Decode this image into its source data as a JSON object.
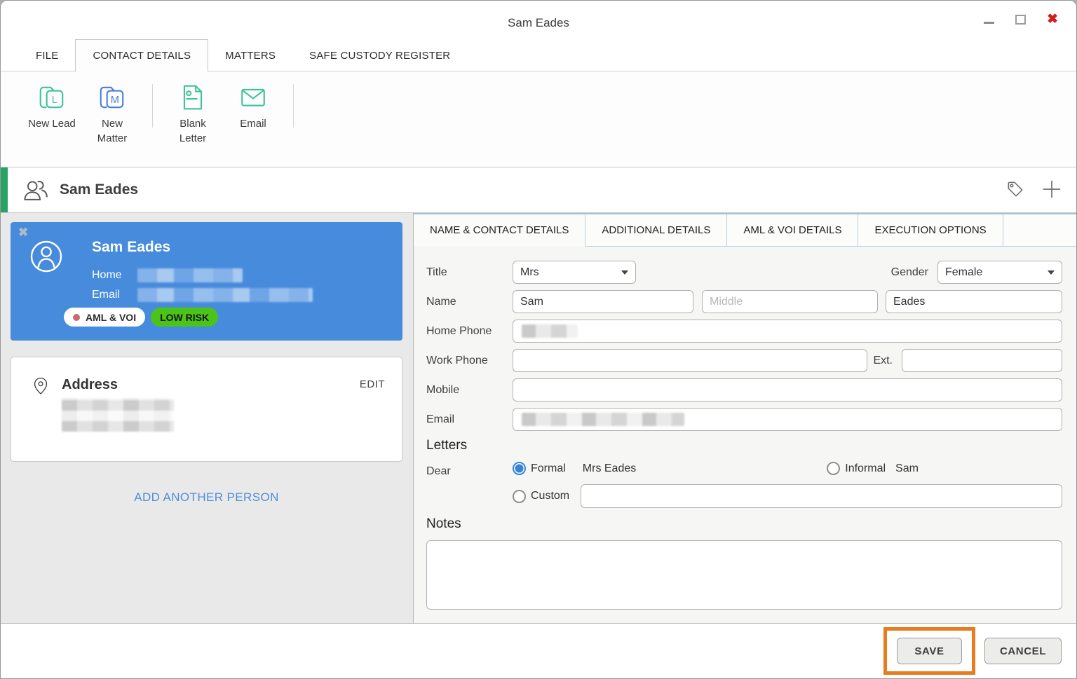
{
  "window": {
    "title": "Sam Eades"
  },
  "menu": {
    "tabs": [
      {
        "label": "FILE",
        "active": false
      },
      {
        "label": "CONTACT DETAILS",
        "active": true
      },
      {
        "label": "MATTERS",
        "active": false
      },
      {
        "label": "SAFE CUSTODY REGISTER",
        "active": false
      }
    ]
  },
  "ribbon": {
    "buttons": [
      {
        "label": "New Lead",
        "icon": "new-lead-folder-icon",
        "letter": "L"
      },
      {
        "label": "New Matter",
        "icon": "new-matter-folder-icon",
        "letter": "M"
      },
      {
        "label": "Blank Letter",
        "icon": "blank-letter-document-icon"
      },
      {
        "label": "Email",
        "icon": "email-envelope-icon"
      }
    ]
  },
  "contact_header": {
    "name": "Sam Eades"
  },
  "people_panel": {
    "person_card": {
      "name": "Sam Eades",
      "home_label": "Home",
      "email_label": "Email",
      "aml_badge": "AML & VOI",
      "risk_badge": "LOW RISK"
    },
    "address_card": {
      "title": "Address",
      "edit_label": "EDIT"
    },
    "add_another_label": "ADD ANOTHER PERSON"
  },
  "detail_tabs": [
    {
      "label": "NAME & CONTACT DETAILS",
      "active": true
    },
    {
      "label": "ADDITIONAL DETAILS",
      "active": false
    },
    {
      "label": "AML & VOI DETAILS",
      "active": false
    },
    {
      "label": "EXECUTION OPTIONS",
      "active": false
    }
  ],
  "form": {
    "title_label": "Title",
    "title_value": "Mrs",
    "gender_label": "Gender",
    "gender_value": "Female",
    "name_label": "Name",
    "first_name": "Sam",
    "middle_name_placeholder": "Middle",
    "last_name": "Eades",
    "home_phone_label": "Home Phone",
    "work_phone_label": "Work Phone",
    "ext_label": "Ext.",
    "mobile_label": "Mobile",
    "email_label": "Email",
    "letters_heading": "Letters",
    "dear_label": "Dear",
    "formal_label": "Formal",
    "formal_value": "Mrs Eades",
    "informal_label": "Informal",
    "informal_value": "Sam",
    "custom_label": "Custom",
    "notes_heading": "Notes"
  },
  "footer": {
    "save_label": "SAVE",
    "cancel_label": "CANCEL"
  },
  "colors": {
    "accent_green": "#28a366",
    "icon_green": "#3dc39a",
    "icon_blue": "#4a7de0",
    "card_blue": "#478bdc",
    "risk_green": "#4cc417",
    "aml_dot_red": "#c76b6e",
    "link_blue": "#4a90d9",
    "save_annotation_orange": "#e87d1e",
    "close_red": "#d21c1c"
  }
}
